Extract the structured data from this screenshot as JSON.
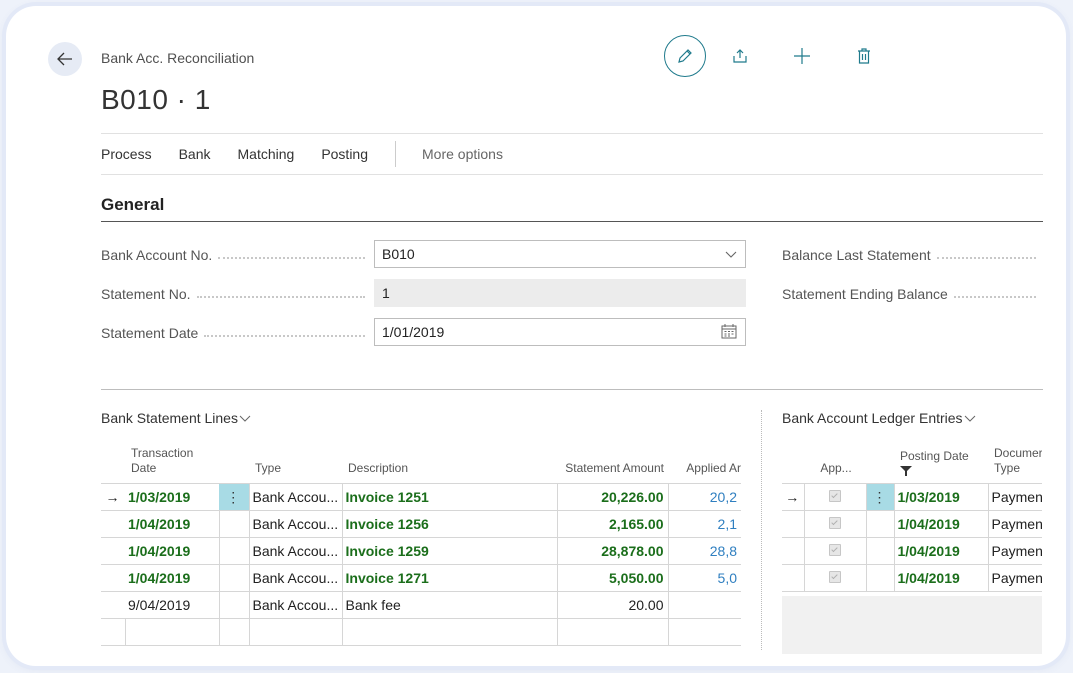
{
  "header": {
    "breadcrumb": "Bank Acc. Reconciliation",
    "title": "B010 · 1",
    "icons": [
      "edit-icon",
      "share-icon",
      "plus-icon",
      "delete-icon"
    ]
  },
  "actions": {
    "items": [
      "Process",
      "Bank",
      "Matching",
      "Posting"
    ],
    "more": "More options"
  },
  "general": {
    "title": "General",
    "bank_account_no_label": "Bank Account No.",
    "bank_account_no_value": "B010",
    "statement_no_label": "Statement No.",
    "statement_no_value": "1",
    "statement_date_label": "Statement Date",
    "statement_date_value": "1/01/2019",
    "balance_last_label": "Balance Last Statement",
    "statement_ending_label": "Statement Ending Balance"
  },
  "statement_lines": {
    "title": "Bank Statement Lines",
    "columns": {
      "transaction_date": "Transaction Date",
      "type": "Type",
      "description": "Description",
      "statement_amount": "Statement Amount",
      "applied": "Applied Ar"
    },
    "rows": [
      {
        "date": "1/03/2019",
        "type": "Bank Accou...",
        "description": "Invoice 1251",
        "amount": "20,226.00",
        "applied": "20,2"
      },
      {
        "date": "1/04/2019",
        "type": "Bank Accou...",
        "description": "Invoice 1256",
        "amount": "2,165.00",
        "applied": "2,1"
      },
      {
        "date": "1/04/2019",
        "type": "Bank Accou...",
        "description": "Invoice 1259",
        "amount": "28,878.00",
        "applied": "28,8"
      },
      {
        "date": "1/04/2019",
        "type": "Bank Accou...",
        "description": "Invoice 1271",
        "amount": "5,050.00",
        "applied": "5,0"
      },
      {
        "date": "9/04/2019",
        "type": "Bank Accou...",
        "description": "Bank fee",
        "amount": "20.00",
        "applied": ""
      }
    ]
  },
  "ledger_entries": {
    "title": "Bank Account Ledger Entries",
    "columns": {
      "applied": "App...",
      "posting_date": "Posting Date",
      "document_type": "Documer Type"
    },
    "rows": [
      {
        "posting_date": "1/03/2019",
        "document_type": "Payment"
      },
      {
        "posting_date": "1/04/2019",
        "document_type": "Payment"
      },
      {
        "posting_date": "1/04/2019",
        "document_type": "Payment"
      },
      {
        "posting_date": "1/04/2019",
        "document_type": "Payment"
      }
    ]
  },
  "colors": {
    "accent": "#1f7a8c",
    "positive": "#1b6e1b",
    "selection": "#a8dbe5"
  }
}
